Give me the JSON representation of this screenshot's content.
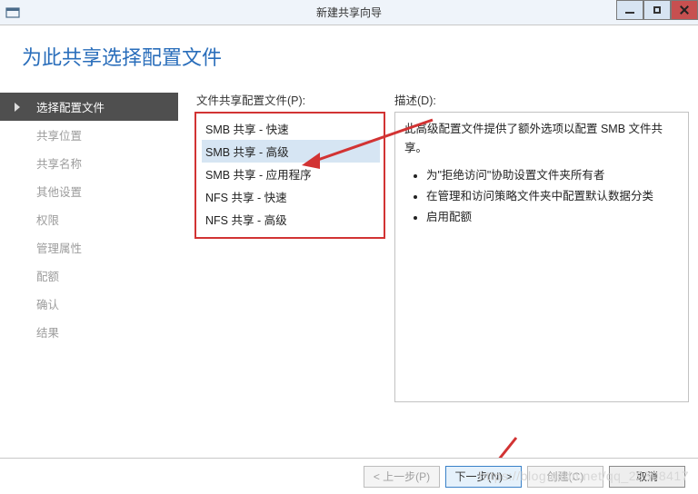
{
  "window": {
    "title": "新建共享向导"
  },
  "header": {
    "heading": "为此共享选择配置文件"
  },
  "sidebar": {
    "items": [
      {
        "label": "选择配置文件",
        "active": true
      },
      {
        "label": "共享位置"
      },
      {
        "label": "共享名称"
      },
      {
        "label": "其他设置"
      },
      {
        "label": "权限"
      },
      {
        "label": "管理属性"
      },
      {
        "label": "配额"
      },
      {
        "label": "确认"
      },
      {
        "label": "结果"
      }
    ]
  },
  "profiles": {
    "label": "文件共享配置文件(P):",
    "items": [
      {
        "label": "SMB 共享 - 快速"
      },
      {
        "label": "SMB 共享 - 高级",
        "selected": true
      },
      {
        "label": "SMB 共享 - 应用程序"
      },
      {
        "label": "NFS 共享 - 快速"
      },
      {
        "label": "NFS 共享 - 高级"
      }
    ]
  },
  "description": {
    "label": "描述(D):",
    "intro": "此高级配置文件提供了额外选项以配置 SMB 文件共享。",
    "bullets": [
      "为\"拒绝访问\"协助设置文件夹所有者",
      "在管理和访问策略文件夹中配置默认数据分类",
      "启用配额"
    ]
  },
  "footer": {
    "prev": "< 上一步(P)",
    "next": "下一步(N) >",
    "create": "创建(C)",
    "cancel": "取消"
  },
  "watermark": "https://blog.csdn.net/qq_29308417"
}
